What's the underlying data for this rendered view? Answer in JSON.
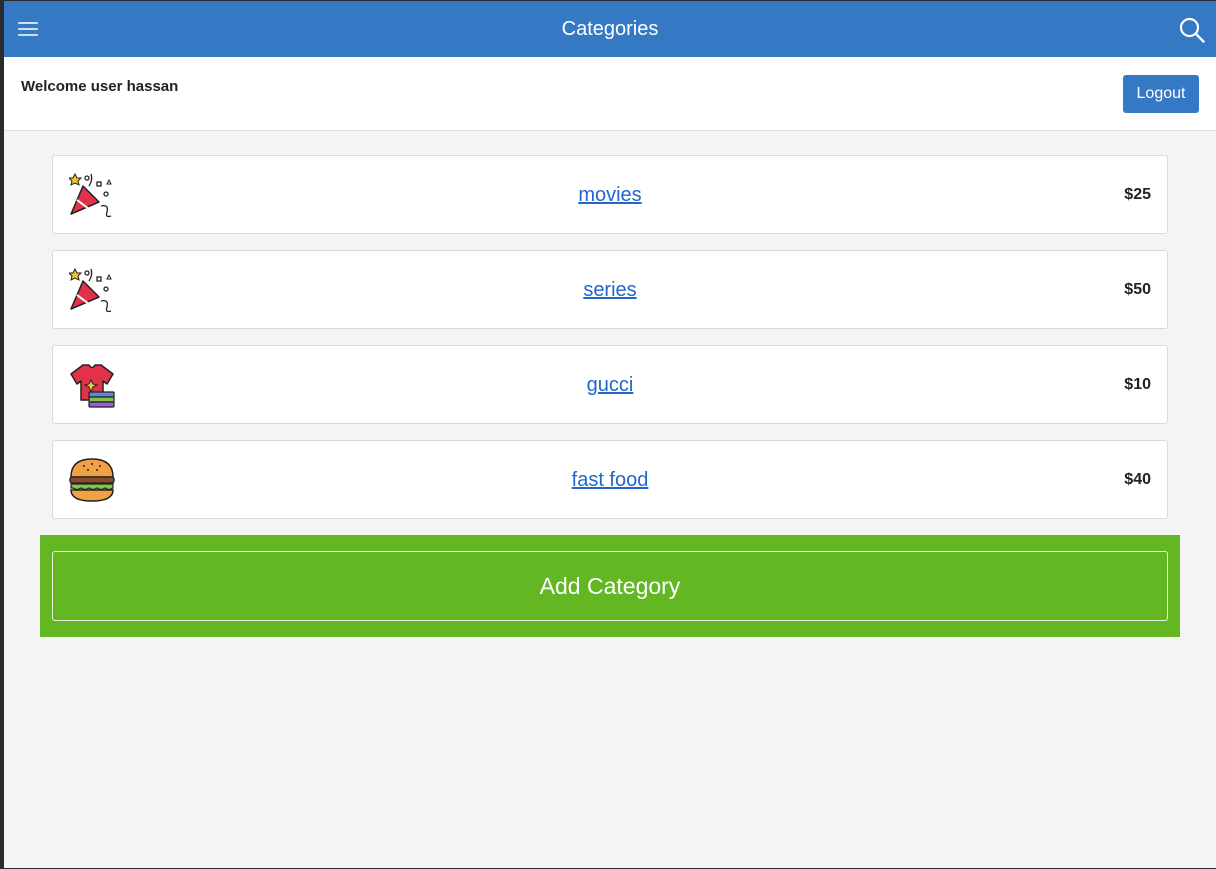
{
  "header": {
    "title": "Categories",
    "menu_icon": "hamburger-menu-icon",
    "search_icon": "search-icon",
    "color": "#3578c4"
  },
  "user_bar": {
    "welcome_text": "Welcome user hassan",
    "logout_label": "Logout"
  },
  "categories": [
    {
      "name": "movies",
      "price": "$25",
      "icon": "party-popper-icon"
    },
    {
      "name": "series",
      "price": "$50",
      "icon": "party-popper-icon"
    },
    {
      "name": "gucci",
      "price": "$10",
      "icon": "tshirt-clothes-icon"
    },
    {
      "name": "fast food",
      "price": "$40",
      "icon": "burger-icon"
    }
  ],
  "add_button": {
    "label": "Add Category",
    "color": "#62b723"
  }
}
